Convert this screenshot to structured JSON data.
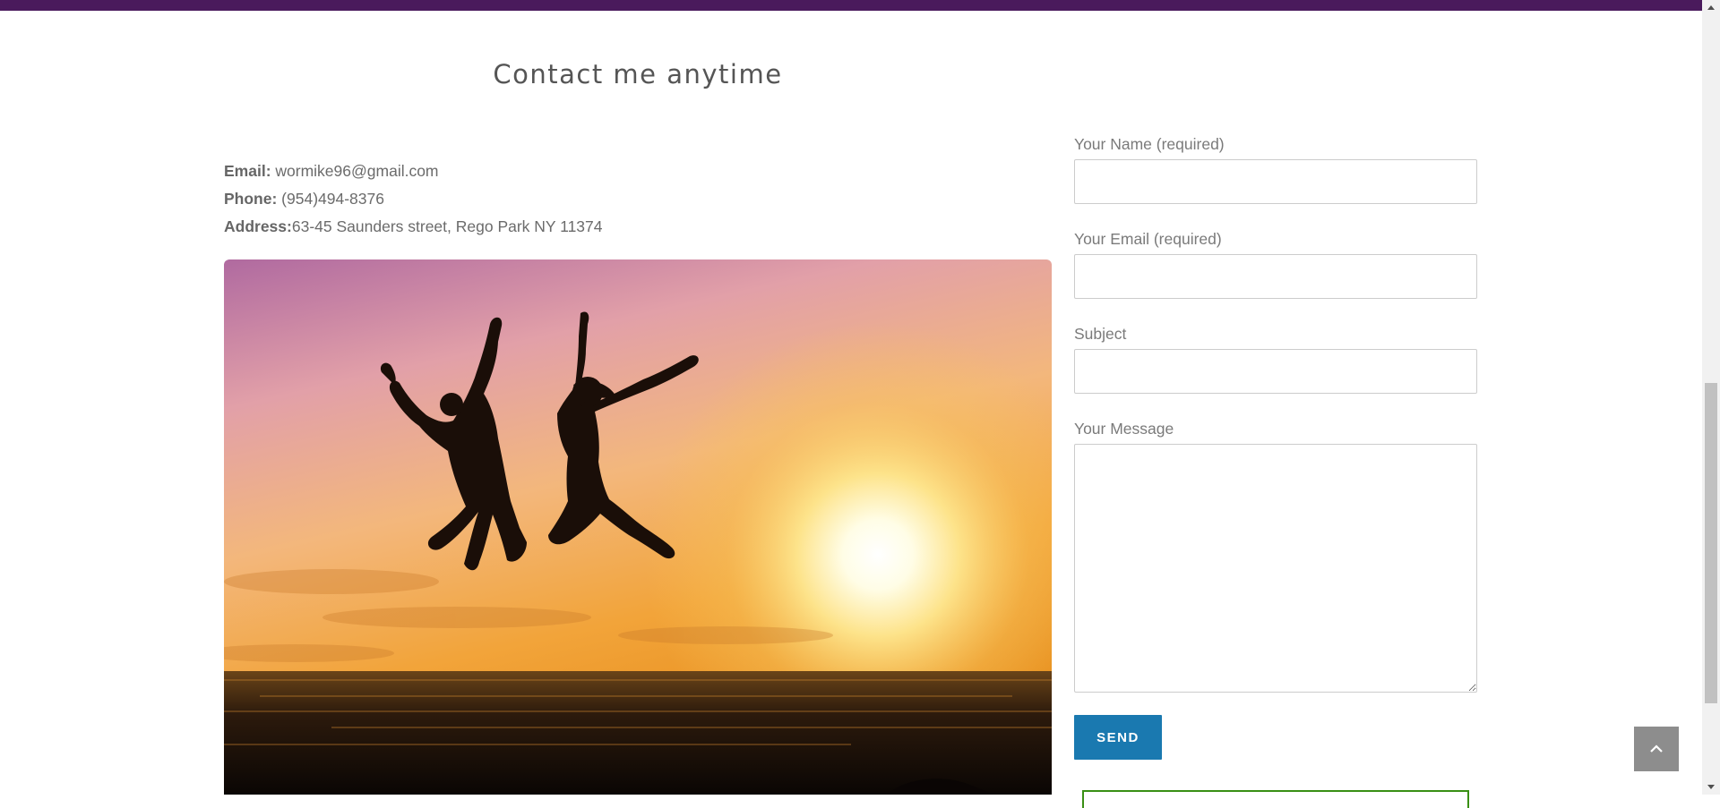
{
  "header": {
    "title": "Contact me anytime"
  },
  "contact": {
    "email_label": "Email:",
    "email_value": " wormike96@gmail.com",
    "phone_label": "Phone:",
    "phone_value": " (954)494-8376",
    "address_label": "Address:",
    "address_value": "63-45 Saunders street, Rego Park NY 11374"
  },
  "form": {
    "name_label": "Your Name (required)",
    "email_label": "Your Email (required)",
    "subject_label": "Subject",
    "message_label": "Your Message",
    "name_value": "",
    "email_value": "",
    "subject_value": "",
    "message_value": "",
    "send_label": "SEND"
  },
  "colors": {
    "top_bar": "#4a1a5c",
    "send_button": "#1a79b0",
    "response_border": "#398f14",
    "back_to_top": "#8d8d8d"
  },
  "icons": {
    "back_to_top": "chevron-up-icon",
    "scroll_up": "triangle-up-icon",
    "scroll_down": "triangle-down-icon"
  }
}
